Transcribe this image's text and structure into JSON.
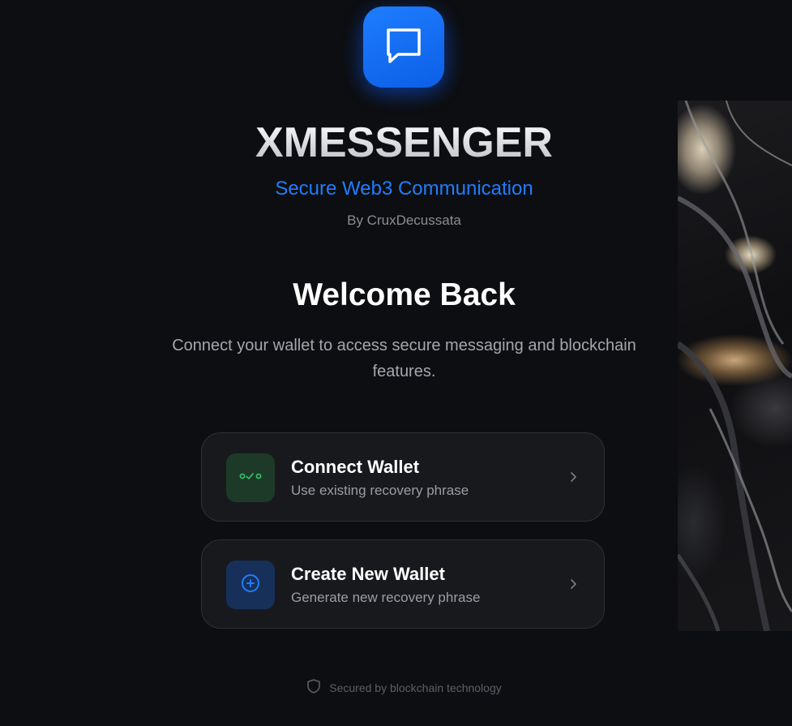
{
  "app": {
    "brand": "XMESSENGER",
    "tagline": "Secure Web3 Communication",
    "byline": "By CruxDecussata",
    "logo_icon": "chat-bubble-icon",
    "accent_color": "#1f7dff"
  },
  "welcome": {
    "heading": "Welcome Back",
    "description": "Connect your wallet to access secure messaging and blockchain features."
  },
  "options": [
    {
      "title": "Connect Wallet",
      "subtitle": "Use existing recovery phrase",
      "icon": "wallet-link-icon",
      "icon_color": "#35c46a"
    },
    {
      "title": "Create New Wallet",
      "subtitle": "Generate new recovery phrase",
      "icon": "plus-circle-icon",
      "icon_color": "#1f7dff"
    }
  ],
  "footer": {
    "text": "Secured by blockchain technology",
    "icon": "shield-icon"
  }
}
